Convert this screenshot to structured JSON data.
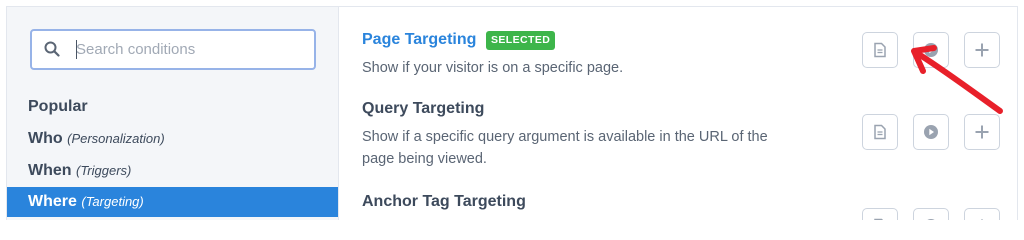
{
  "search": {
    "placeholder": "Search conditions"
  },
  "sidebar": {
    "categories": [
      {
        "label": "Popular",
        "sub": ""
      },
      {
        "label": "Who",
        "sub": "(Personalization)"
      },
      {
        "label": "When",
        "sub": "(Triggers)"
      },
      {
        "label": "Where",
        "sub": "(Targeting)"
      }
    ]
  },
  "conditions": [
    {
      "title": "Page Targeting",
      "badge": "SELECTED",
      "description": "Show if your visitor is on a specific page."
    },
    {
      "title": "Query Targeting",
      "description_line1": "Show if a specific query argument is available in the URL of the",
      "description_line2": "page being viewed."
    },
    {
      "title": "Anchor Tag Targeting"
    }
  ],
  "actions": [
    "document-icon",
    "play-icon",
    "plus-icon"
  ],
  "colors": {
    "accent": "#2a84dc",
    "badge": "#3db54a",
    "arrow": "#e8202a"
  }
}
